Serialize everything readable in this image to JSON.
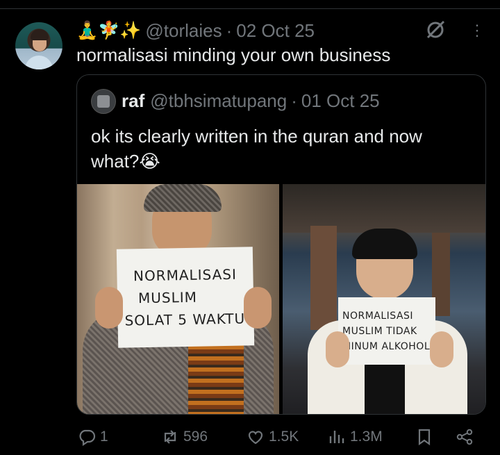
{
  "tweet": {
    "emojis": "🧘‍♂️🧚✨",
    "handle": "@torlaies",
    "separator": "·",
    "date": "02 Oct 25",
    "text": "normalisasi minding your own business"
  },
  "quoted_tweet": {
    "name": "raf",
    "handle": "@tbhsimatupang",
    "separator": "·",
    "date": "01 Oct 25",
    "text": "ok its clearly written in the quran and now what?",
    "emoji": "😭",
    "photos": [
      {
        "sign_lines": [
          "NORMALISASI",
          "MUSLIM",
          "SOLAT 5 WAKTU"
        ]
      },
      {
        "sign_lines": [
          "NORMALISASI",
          "MUSLIM TIDAK",
          "MINUM ALKOHOL"
        ]
      }
    ]
  },
  "actions": {
    "replies": "1",
    "reposts": "596",
    "likes": "1.5K",
    "views": "1.3M"
  },
  "icons": [
    "grok-icon",
    "more-icon",
    "reply-icon",
    "repost-icon",
    "like-icon",
    "views-icon",
    "bookmark-icon",
    "share-icon"
  ],
  "colors": {
    "background": "#000000",
    "text": "#e7e9ea",
    "muted": "#71767b",
    "border": "#2f3336"
  }
}
